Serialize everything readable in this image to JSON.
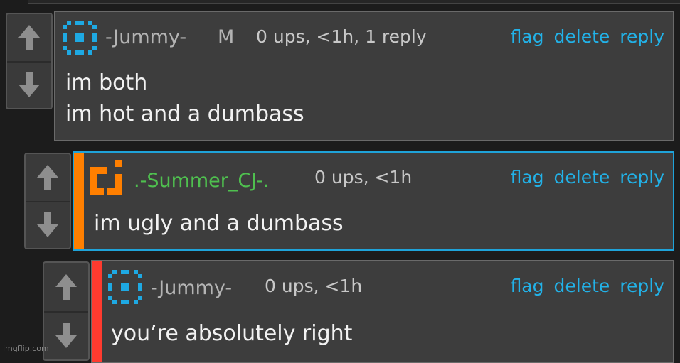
{
  "comments": [
    {
      "username": "-Jummy-",
      "badge": "M",
      "meta": "0 ups, <1h, 1 reply",
      "lines": [
        "im both",
        "im hot and a dumbass"
      ],
      "actions": {
        "flag": "flag",
        "delete": "delete",
        "reply": "reply"
      },
      "avatar": "blue-pixel-avatar-icon",
      "colors": {
        "avatar": "#1ea9e3",
        "username": "#b4b4b4"
      }
    },
    {
      "username": ".-Summer_CJ-.",
      "meta": "0 ups, <1h",
      "lines": [
        "im ugly and a dumbass"
      ],
      "actions": {
        "flag": "flag",
        "delete": "delete",
        "reply": "reply"
      },
      "avatar": "orange-bracket-avatar-icon",
      "colors": {
        "avatar": "#ff7f00",
        "username": "#4fc04f",
        "stripe": "#ff7f00",
        "border": "#1fa3d9"
      }
    },
    {
      "username": "-Jummy-",
      "meta": "0 ups, <1h",
      "lines": [
        "you’re absolutely right"
      ],
      "actions": {
        "flag": "flag",
        "delete": "delete",
        "reply": "reply"
      },
      "avatar": "blue-pixel-avatar-icon",
      "colors": {
        "avatar": "#1ea9e3",
        "username": "#b4b4b4",
        "stripe": "#ff3b2f"
      }
    }
  ],
  "watermark": "imgflip.com",
  "colors": {
    "link": "#22b2e8",
    "background": "#1c1c1c",
    "panel": "#3d3d3d"
  }
}
